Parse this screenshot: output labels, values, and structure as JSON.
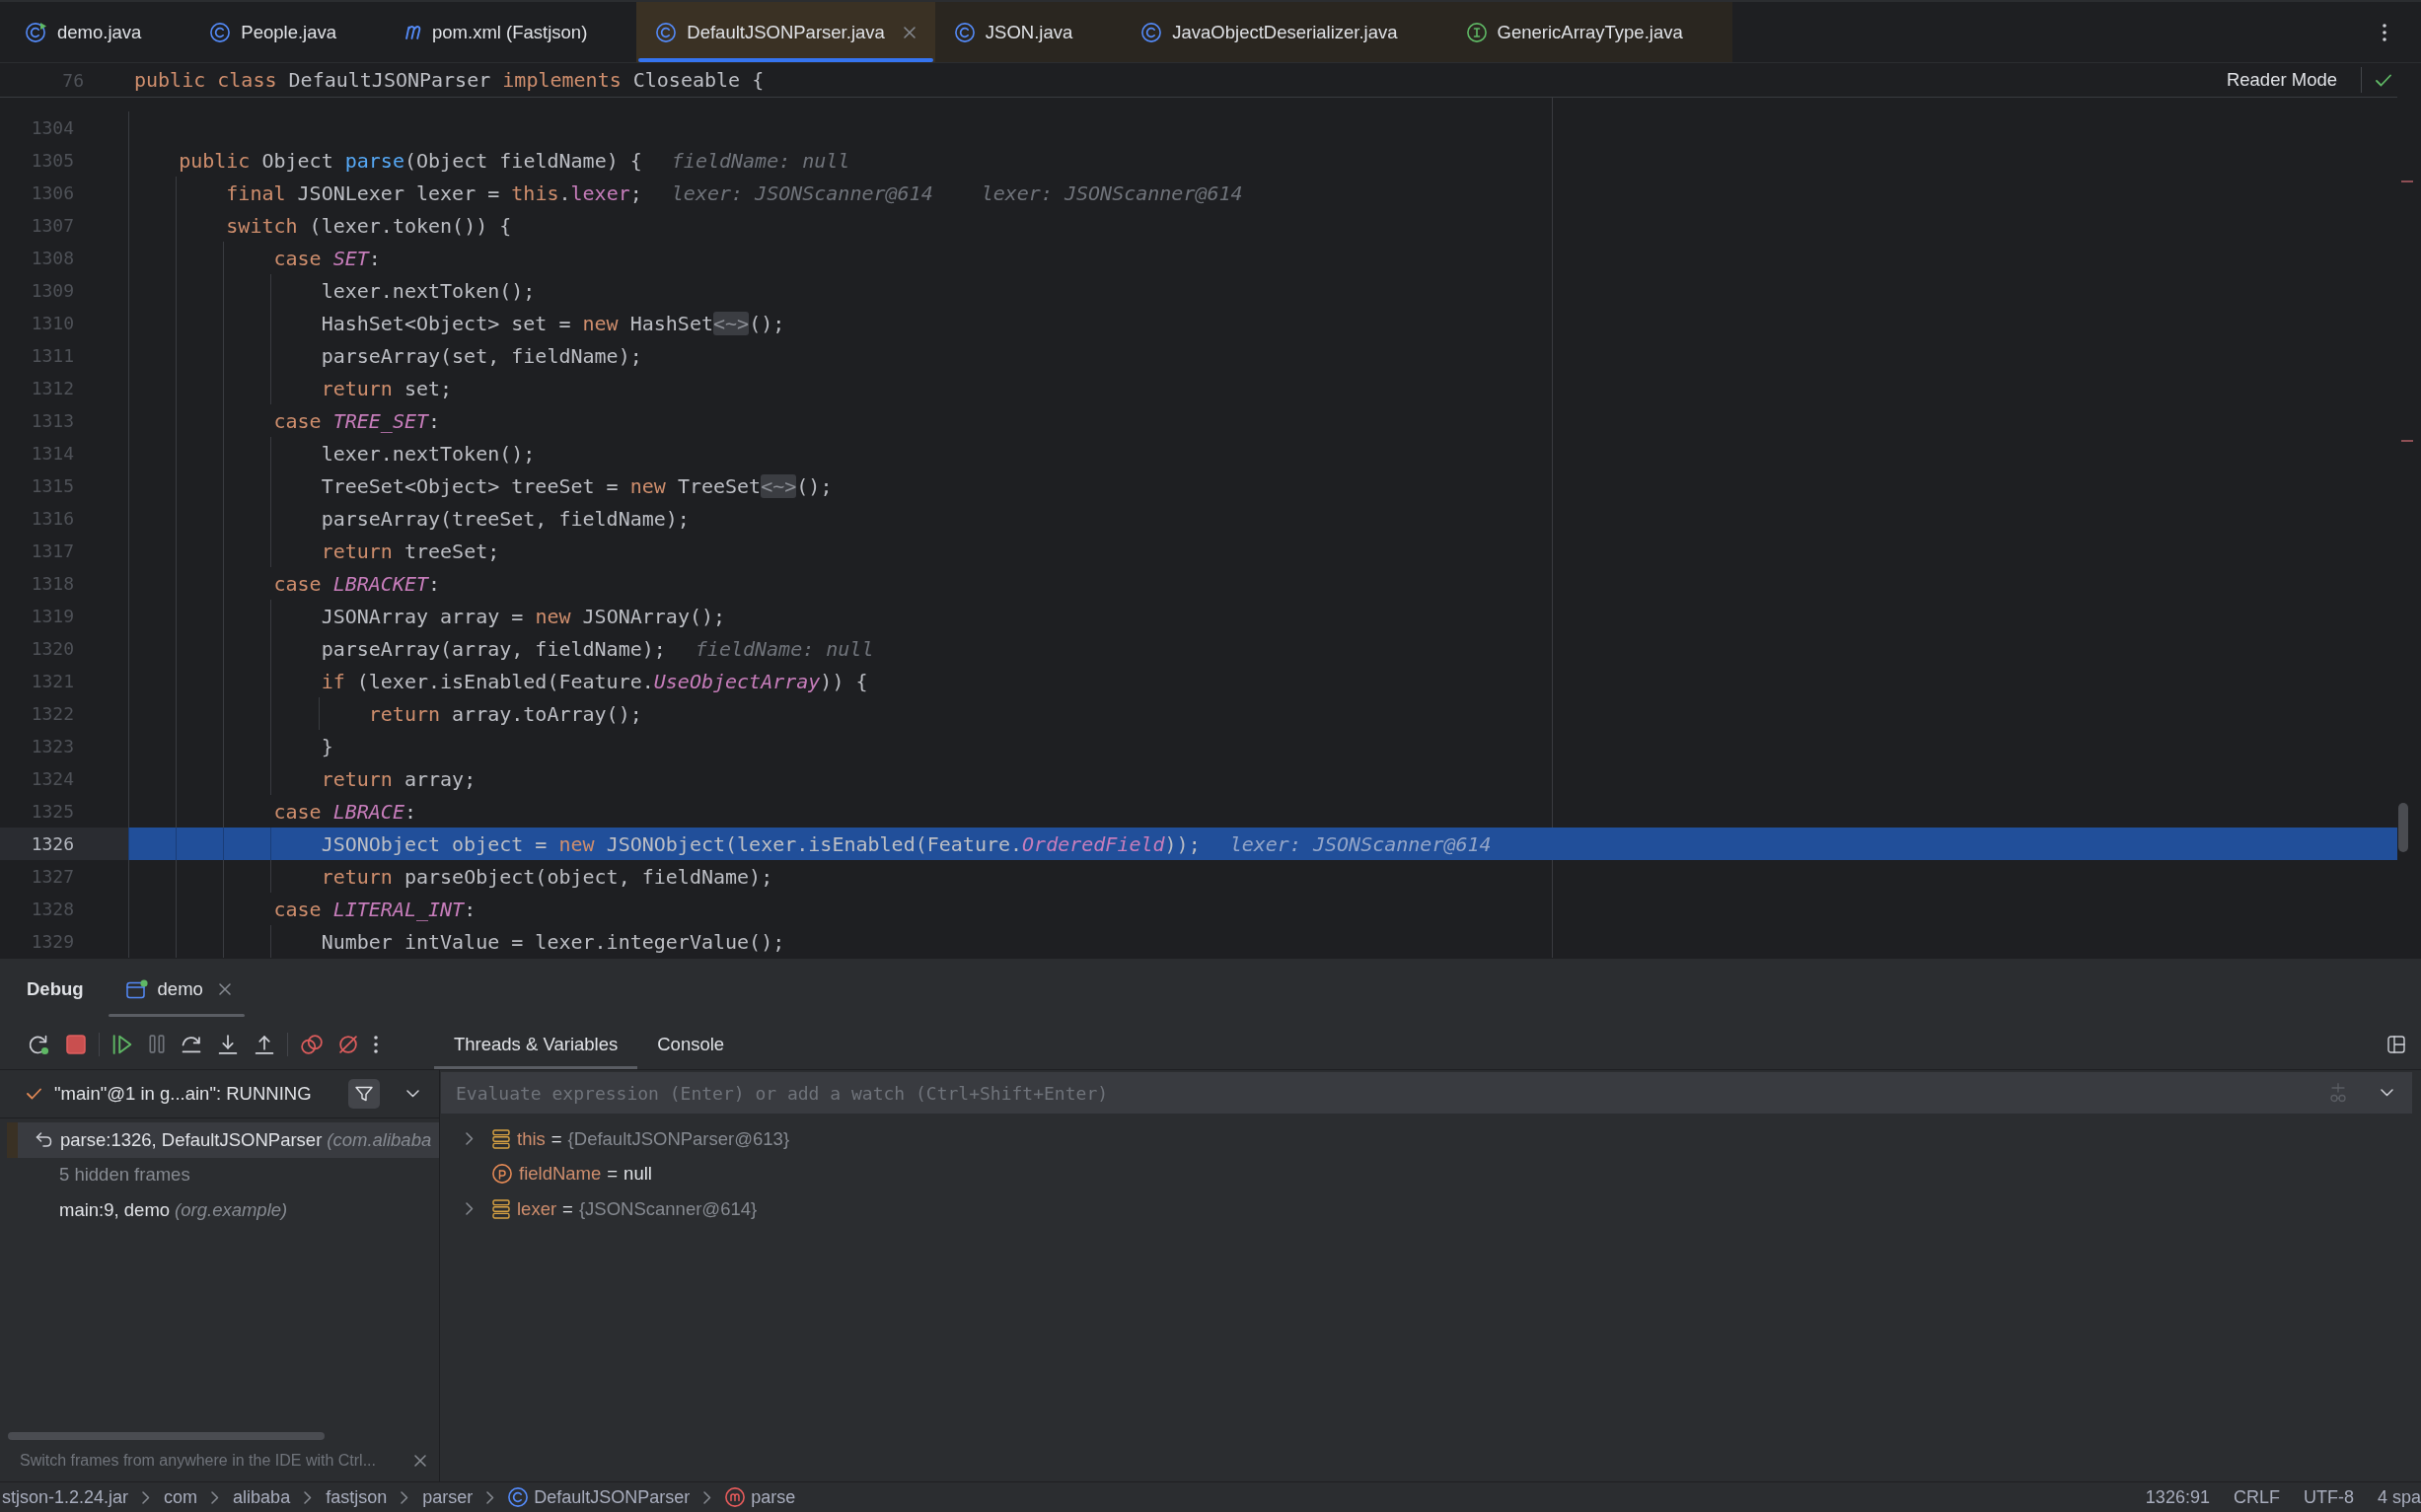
{
  "editor_tabs": [
    {
      "label": "demo.java",
      "kind": "main_class",
      "library": false,
      "selected": false
    },
    {
      "label": "People.java",
      "kind": "class",
      "library": false,
      "selected": false
    },
    {
      "label": "pom.xml (Fastjson)",
      "kind": "maven",
      "library": false,
      "selected": false
    },
    {
      "label": "DefaultJSONParser.java",
      "kind": "class",
      "library": true,
      "selected": true
    },
    {
      "label": "JSON.java",
      "kind": "class",
      "library": true,
      "selected": false
    },
    {
      "label": "JavaObjectDeserializer.java",
      "kind": "class",
      "library": true,
      "selected": false
    },
    {
      "label": "GenericArrayType.java",
      "kind": "interface",
      "library": true,
      "selected": false
    }
  ],
  "editor": {
    "sticky_line": {
      "number": "76",
      "code": [
        {
          "text": "public class ",
          "kind": "keyword"
        },
        {
          "text": "DefaultJSONParser ",
          "kind": "plain"
        },
        {
          "text": "implements ",
          "kind": "keyword"
        },
        {
          "text": "Closeable {",
          "kind": "plain"
        }
      ]
    },
    "reader_mode": "Reader Mode",
    "lines": [
      {
        "number": "1304",
        "current": false
      },
      {
        "number": "1305",
        "current": false,
        "code": [
          {
            "text": "public ",
            "kind": "keyword"
          },
          {
            "text": "Object ",
            "kind": "plain"
          },
          {
            "text": "parse",
            "kind": "method"
          },
          {
            "text": "(Object fieldName) {",
            "kind": "plain"
          }
        ],
        "hints": [
          "fieldName: null"
        ],
        "children": [
          {
            "number": "1306",
            "current": false,
            "code": [
              {
                "text": "final ",
                "kind": "keyword"
              },
              {
                "text": "JSONLexer lexer = ",
                "kind": "plain"
              },
              {
                "text": "this",
                "kind": "keyword"
              },
              {
                "text": ".",
                "kind": "plain"
              },
              {
                "text": "lexer",
                "kind": "field"
              },
              {
                "text": ";",
                "kind": "plain"
              }
            ],
            "hints": [
              "lexer: JSONScanner@614",
              "lexer: JSONScanner@614"
            ]
          },
          {
            "number": "1307",
            "current": false,
            "code": [
              {
                "text": "switch ",
                "kind": "keyword"
              },
              {
                "text": "(lexer.token()) {",
                "kind": "plain"
              }
            ],
            "children": [
              {
                "number": "1308",
                "current": false,
                "code": [
                  {
                    "text": "case ",
                    "kind": "keyword"
                  },
                  {
                    "text": "SET",
                    "kind": "constant"
                  },
                  {
                    "text": ":",
                    "kind": "plain"
                  }
                ],
                "children": [
                  {
                    "number": "1309",
                    "current": false,
                    "code": [
                      {
                        "text": "lexer.nextToken();",
                        "kind": "plain"
                      }
                    ]
                  },
                  {
                    "number": "1310",
                    "current": false,
                    "code": [
                      {
                        "text": "HashSet<Object> set = ",
                        "kind": "plain"
                      },
                      {
                        "text": "new ",
                        "kind": "keyword"
                      },
                      {
                        "text": "HashSet",
                        "kind": "plain"
                      },
                      {
                        "text": "<~>",
                        "kind": "fold"
                      },
                      {
                        "text": "();",
                        "kind": "plain"
                      }
                    ]
                  },
                  {
                    "number": "1311",
                    "current": false,
                    "code": [
                      {
                        "text": "parseArray(set, fieldName);",
                        "kind": "plain"
                      }
                    ]
                  },
                  {
                    "number": "1312",
                    "current": false,
                    "code": [
                      {
                        "text": "return ",
                        "kind": "keyword"
                      },
                      {
                        "text": "set;",
                        "kind": "plain"
                      }
                    ]
                  }
                ]
              },
              {
                "number": "1313",
                "current": false,
                "code": [
                  {
                    "text": "case ",
                    "kind": "keyword"
                  },
                  {
                    "text": "TREE_SET",
                    "kind": "constant"
                  },
                  {
                    "text": ":",
                    "kind": "plain"
                  }
                ],
                "children": [
                  {
                    "number": "1314",
                    "current": false,
                    "code": [
                      {
                        "text": "lexer.nextToken();",
                        "kind": "plain"
                      }
                    ]
                  },
                  {
                    "number": "1315",
                    "current": false,
                    "code": [
                      {
                        "text": "TreeSet<Object> treeSet = ",
                        "kind": "plain"
                      },
                      {
                        "text": "new ",
                        "kind": "keyword"
                      },
                      {
                        "text": "TreeSet",
                        "kind": "plain"
                      },
                      {
                        "text": "<~>",
                        "kind": "fold"
                      },
                      {
                        "text": "();",
                        "kind": "plain"
                      }
                    ]
                  },
                  {
                    "number": "1316",
                    "current": false,
                    "code": [
                      {
                        "text": "parseArray(treeSet, fieldName);",
                        "kind": "plain"
                      }
                    ]
                  },
                  {
                    "number": "1317",
                    "current": false,
                    "code": [
                      {
                        "text": "return ",
                        "kind": "keyword"
                      },
                      {
                        "text": "treeSet;",
                        "kind": "plain"
                      }
                    ]
                  }
                ]
              },
              {
                "number": "1318",
                "current": false,
                "code": [
                  {
                    "text": "case ",
                    "kind": "keyword"
                  },
                  {
                    "text": "LBRACKET",
                    "kind": "constant"
                  },
                  {
                    "text": ":",
                    "kind": "plain"
                  }
                ],
                "children": [
                  {
                    "number": "1319",
                    "current": false,
                    "code": [
                      {
                        "text": "JSONArray array = ",
                        "kind": "plain"
                      },
                      {
                        "text": "new ",
                        "kind": "keyword"
                      },
                      {
                        "text": "JSONArray();",
                        "kind": "plain"
                      }
                    ]
                  },
                  {
                    "number": "1320",
                    "current": false,
                    "code": [
                      {
                        "text": "parseArray(array, fieldName);",
                        "kind": "plain"
                      }
                    ],
                    "hints": [
                      "fieldName: null"
                    ]
                  },
                  {
                    "number": "1321",
                    "current": false,
                    "code": [
                      {
                        "text": "if ",
                        "kind": "keyword"
                      },
                      {
                        "text": "(lexer.isEnabled(Feature.",
                        "kind": "plain"
                      },
                      {
                        "text": "UseObjectArray",
                        "kind": "constant"
                      },
                      {
                        "text": ")) {",
                        "kind": "plain"
                      }
                    ],
                    "children": [
                      {
                        "number": "1322",
                        "current": false,
                        "code": [
                          {
                            "text": "return ",
                            "kind": "keyword"
                          },
                          {
                            "text": "array.toArray();",
                            "kind": "plain"
                          }
                        ]
                      }
                    ]
                  },
                  {
                    "number": "1323",
                    "current": false,
                    "code": [
                      {
                        "text": "}",
                        "kind": "plain"
                      }
                    ]
                  },
                  {
                    "number": "1324",
                    "current": false,
                    "code": [
                      {
                        "text": "return ",
                        "kind": "keyword"
                      },
                      {
                        "text": "array;",
                        "kind": "plain"
                      }
                    ]
                  }
                ]
              },
              {
                "number": "1325",
                "current": false,
                "code": [
                  {
                    "text": "case ",
                    "kind": "keyword"
                  },
                  {
                    "text": "LBRACE",
                    "kind": "constant"
                  },
                  {
                    "text": ":",
                    "kind": "plain"
                  }
                ],
                "children": [
                  {
                    "number": "1326",
                    "current": true,
                    "code": [
                      {
                        "text": "JSONObject object = ",
                        "kind": "plain"
                      },
                      {
                        "text": "new ",
                        "kind": "keyword"
                      },
                      {
                        "text": "JSONObject(lexer.isEnabled(Feature.",
                        "kind": "plain"
                      },
                      {
                        "text": "OrderedField",
                        "kind": "constant"
                      },
                      {
                        "text": "));",
                        "kind": "plain"
                      }
                    ],
                    "hints": [
                      "lexer: JSONScanner@614"
                    ]
                  },
                  {
                    "number": "1327",
                    "current": false,
                    "code": [
                      {
                        "text": "return ",
                        "kind": "keyword"
                      },
                      {
                        "text": "parseObject(object, fieldName);",
                        "kind": "plain"
                      }
                    ]
                  }
                ]
              },
              {
                "number": "1328",
                "current": false,
                "code": [
                  {
                    "text": "case ",
                    "kind": "keyword"
                  },
                  {
                    "text": "LITERAL_INT",
                    "kind": "constant"
                  },
                  {
                    "text": ":",
                    "kind": "plain"
                  }
                ],
                "children": [
                  {
                    "number": "1329",
                    "current": false,
                    "code": [
                      {
                        "text": "Number intValue = lexer.integerValue();",
                        "kind": "plain"
                      }
                    ]
                  }
                ]
              }
            ]
          }
        ]
      }
    ]
  },
  "debug": {
    "title": "Debug",
    "sessions": [
      {
        "label": "demo",
        "selected": true
      }
    ],
    "toolbar": [
      {
        "buttons": [
          {
            "kind": "rerun",
            "disabled": false
          },
          {
            "kind": "stop",
            "disabled": false
          }
        ]
      },
      {
        "buttons": [
          {
            "kind": "resume",
            "disabled": false
          },
          {
            "kind": "pause",
            "disabled": true
          },
          {
            "kind": "step_over",
            "disabled": false
          },
          {
            "kind": "step_into",
            "disabled": false
          },
          {
            "kind": "step_out",
            "disabled": false
          }
        ]
      },
      {
        "buttons": [
          {
            "kind": "view_breakpoints",
            "disabled": false
          },
          {
            "kind": "mute_breakpoints",
            "disabled": false
          },
          {
            "kind": "more",
            "disabled": false
          }
        ]
      }
    ],
    "panel_tabs": [
      {
        "label": "Threads & Variables",
        "selected": true
      },
      {
        "label": "Console",
        "selected": false
      }
    ],
    "thread": {
      "label": "\"main\"@1 in g...ain\": RUNNING",
      "filter_on": true
    },
    "frames": [
      {
        "kind": "top",
        "location": "parse:1326, DefaultJSONParser",
        "package": "(com.alibaba",
        "library": true,
        "selected": true
      },
      {
        "kind": "hidden",
        "location": "5 hidden frames",
        "library": false,
        "selected": false
      },
      {
        "kind": "frame",
        "location": "main:9, demo",
        "package": "(org.example)",
        "library": false,
        "selected": false
      }
    ],
    "hint": "Switch frames from anywhere in the IDE with Ctrl...",
    "evaluate": {
      "placeholder": "Evaluate expression (Enter) or add a watch (Ctrl+Shift+Enter)",
      "add_watch_disabled": true
    },
    "variables": [
      {
        "kind": "field",
        "name": "this",
        "op": "=",
        "value": "{DefaultJSONParser@613}",
        "expanded": false
      },
      {
        "kind": "parameter",
        "name": "fieldName",
        "op": "=",
        "value": "null"
      },
      {
        "kind": "field",
        "name": "lexer",
        "op": "=",
        "value": "{JSONScanner@614}",
        "expanded": false
      }
    ]
  },
  "status_bar": {
    "breadcrumbs": [
      {
        "label": "stjson-1.2.24.jar",
        "kind": "plain"
      },
      {
        "label": "com",
        "kind": "plain"
      },
      {
        "label": "alibaba",
        "kind": "plain"
      },
      {
        "label": "fastjson",
        "kind": "plain"
      },
      {
        "label": "parser",
        "kind": "plain"
      },
      {
        "label": "DefaultJSONParser",
        "kind": "class"
      },
      {
        "label": "parse",
        "kind": "method"
      }
    ],
    "widgets": [
      "1326:91",
      "CRLF",
      "UTF-8",
      "4 spa"
    ]
  }
}
